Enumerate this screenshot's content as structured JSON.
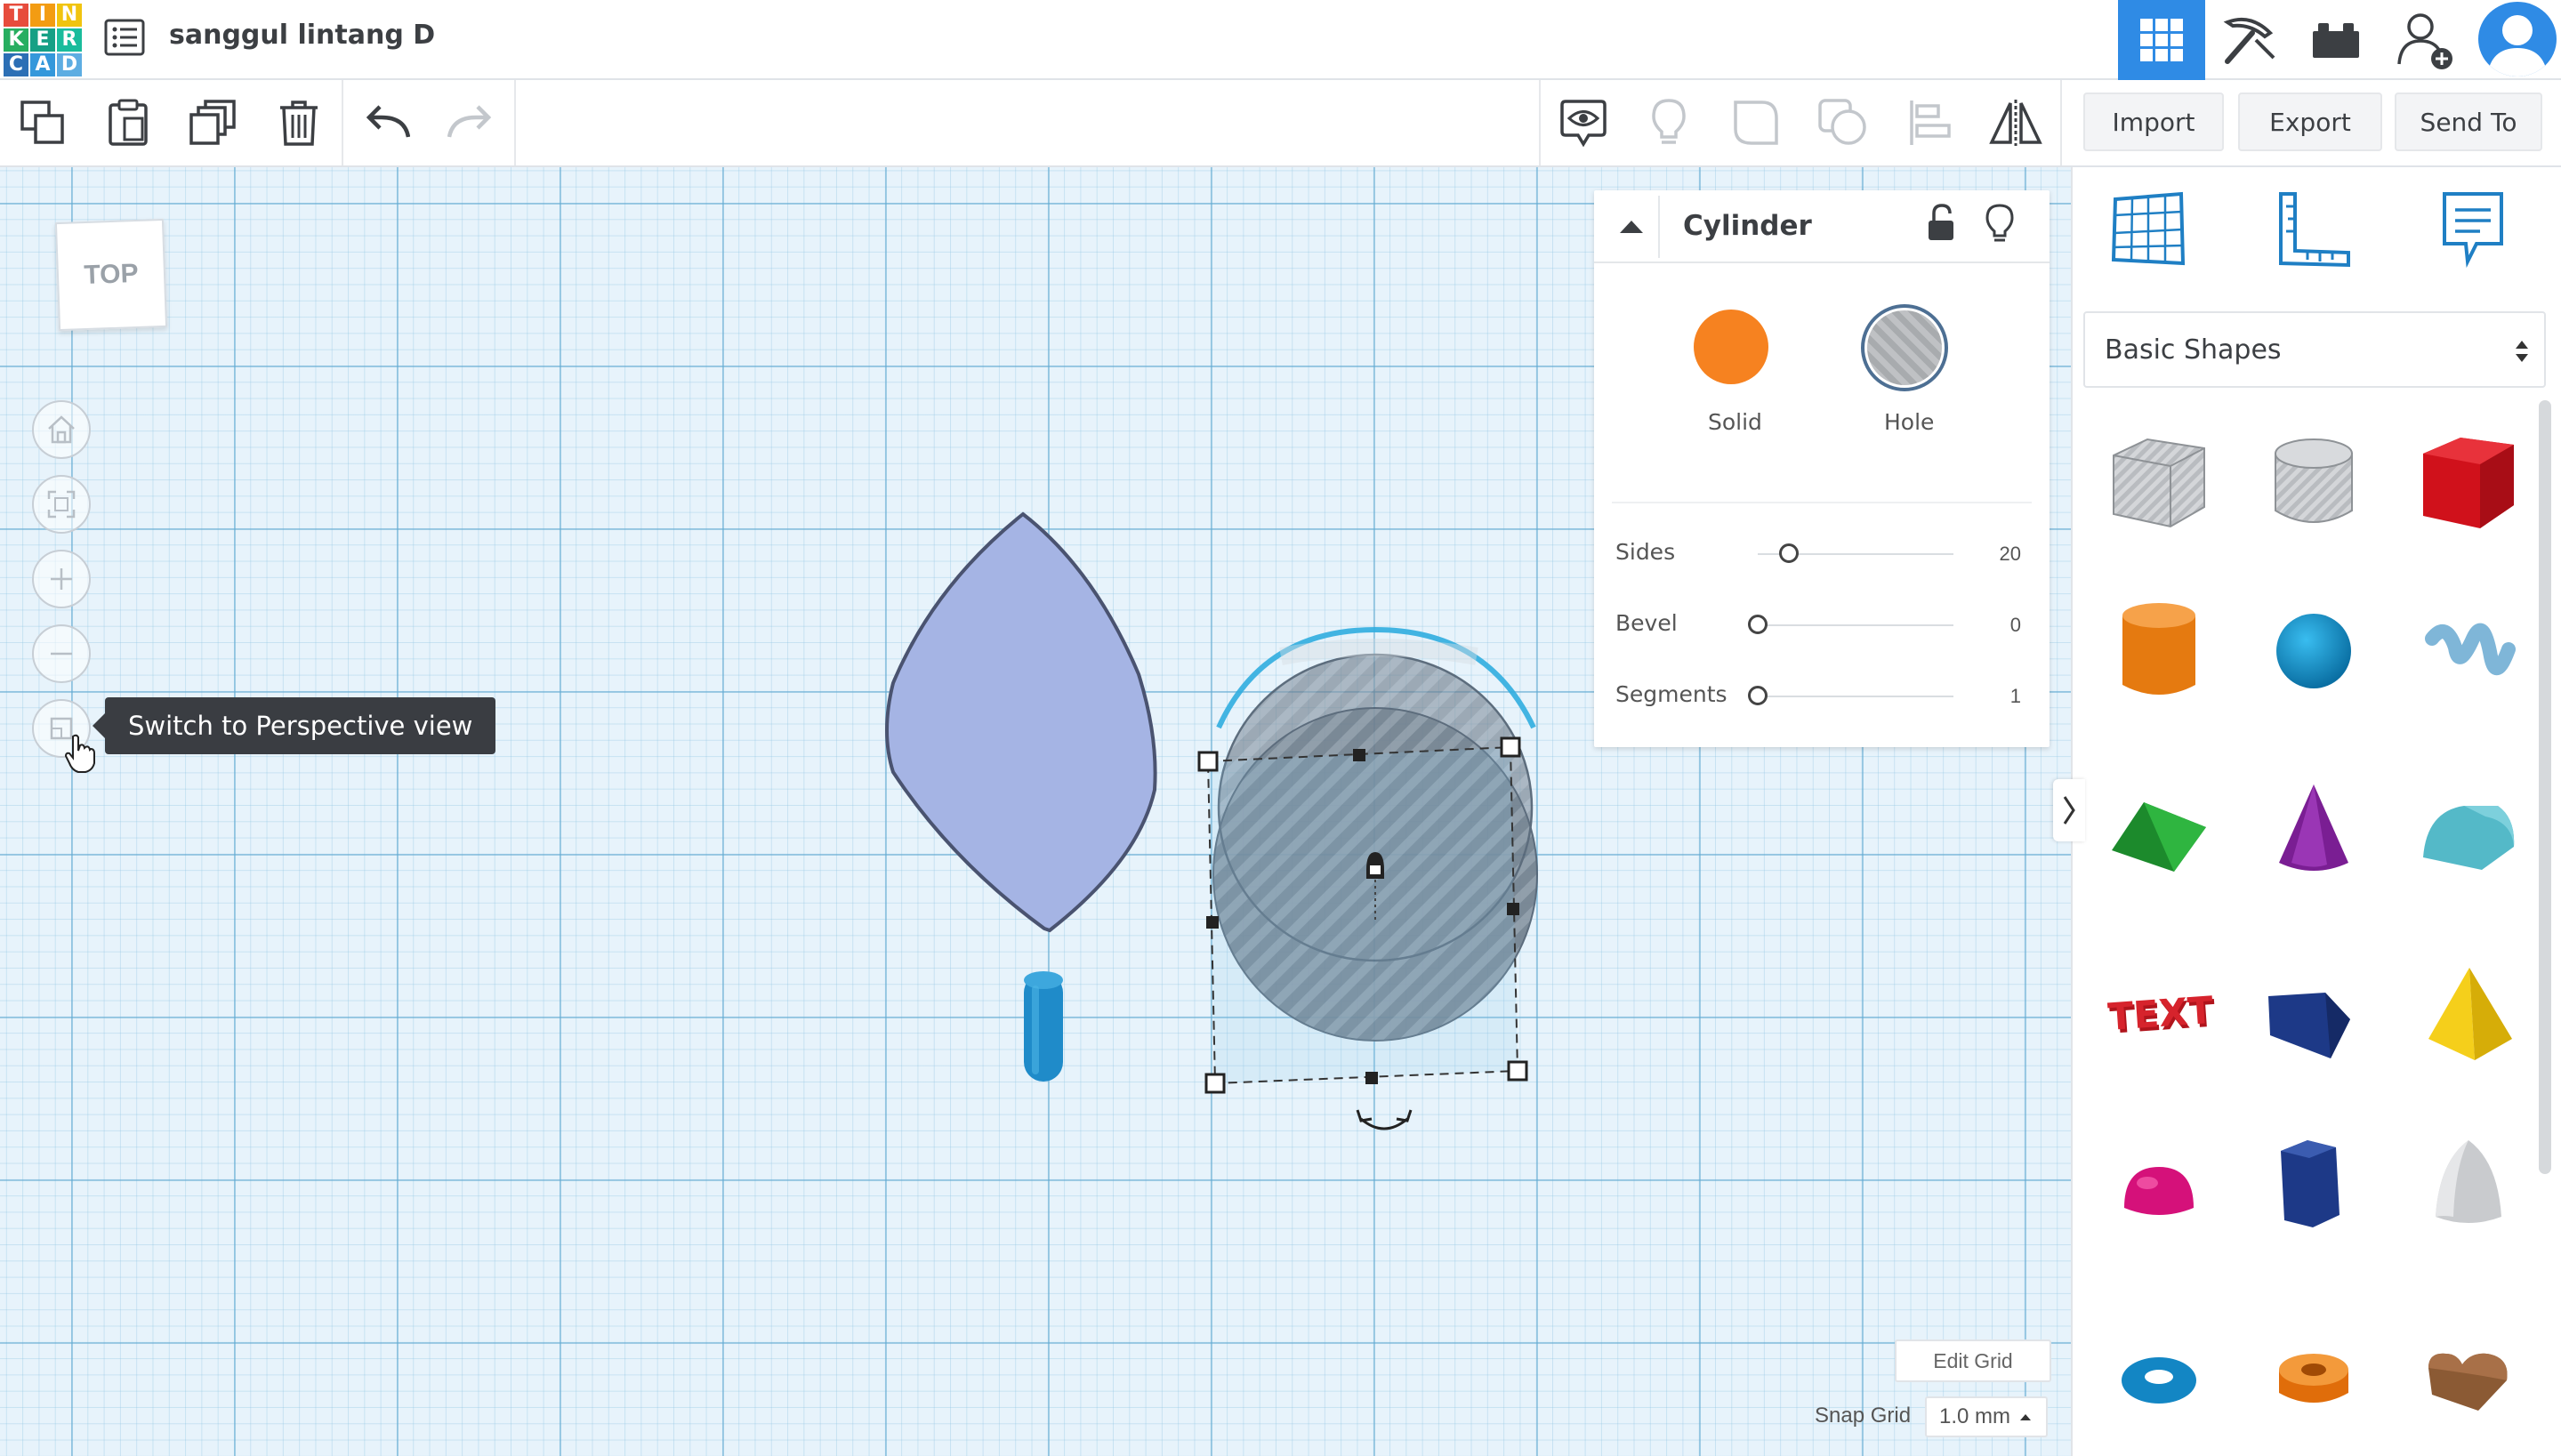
{
  "header": {
    "logo_letters": [
      "T",
      "I",
      "N",
      "K",
      "E",
      "R",
      "C",
      "A",
      "D"
    ],
    "design_title": "sanggul lintang D",
    "nav": [
      "3d-design-view-icon",
      "codeblocks-icon",
      "bricks-icon",
      "invite-user-icon",
      "user-avatar-icon"
    ]
  },
  "toolbar": {
    "import_label": "Import",
    "export_label": "Export",
    "send_to_label": "Send To"
  },
  "viewcube": {
    "label": "TOP"
  },
  "view_controls": {
    "tooltip": "Switch to Perspective view"
  },
  "inspector": {
    "title": "Cylinder",
    "solid_label": "Solid",
    "hole_label": "Hole",
    "colors": {
      "solid": "#f68220",
      "hole": "#c4c6c8"
    },
    "params": [
      {
        "label": "Sides",
        "value": "20",
        "fraction": 0.16
      },
      {
        "label": "Bevel",
        "value": "0",
        "fraction": 0.0
      },
      {
        "label": "Segments",
        "value": "1",
        "fraction": 0.0
      }
    ]
  },
  "library": {
    "category": "Basic Shapes",
    "shapes": [
      "box-hole",
      "cylinder-hole",
      "box",
      "cylinder",
      "sphere",
      "scribble",
      "roof",
      "cone",
      "round-roof",
      "text",
      "half-cube",
      "pyramid",
      "half-sphere",
      "polygon",
      "paraboloid",
      "torus",
      "tube",
      "heart"
    ]
  },
  "grid": {
    "edit_grid_label": "Edit Grid",
    "snap_grid_label": "Snap Grid",
    "snap_value": "1.0 mm"
  }
}
